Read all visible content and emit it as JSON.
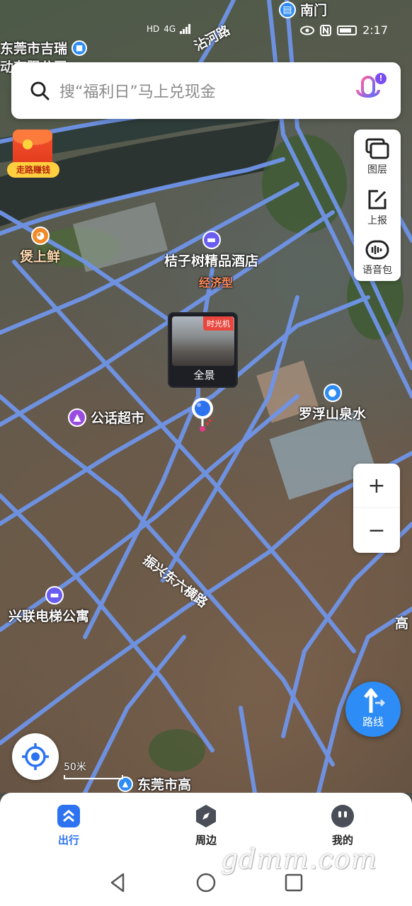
{
  "status_bar": {
    "indicators": [
      "HD",
      "4G",
      "signal"
    ],
    "time": "2:17",
    "right_icons": [
      "eye-icon",
      "nfc-icon",
      "battery-icon"
    ]
  },
  "search": {
    "placeholder": "搜“福利日”马上兑现金",
    "voice_badge": "!"
  },
  "envelope": {
    "label": "走路赚钱"
  },
  "tools": [
    {
      "label": "图层",
      "icon": "layers-icon"
    },
    {
      "label": "上报",
      "icon": "edit-report-icon"
    },
    {
      "label": "语音包",
      "icon": "voice-pack-icon"
    }
  ],
  "map": {
    "labels": {
      "company": "东莞市吉瑞",
      "company_line2": "动有限公司",
      "nanmen": "南门",
      "road_zhanhe": "沾河路",
      "food": "煲上鲜",
      "hotel": "桔子树精品酒店",
      "hotel_type": "经济型",
      "market": "公话超市",
      "water": "罗浮山泉水",
      "road_zhenxing": "振兴东六横路",
      "apartment": "兴联电梯公寓",
      "edge_right": "高",
      "bottom_poi": "东莞市高"
    }
  },
  "street_view": {
    "tag": "时光机",
    "caption": "全景"
  },
  "zoom": {
    "in": "+",
    "out": "−"
  },
  "route": {
    "label": "路线"
  },
  "scale": {
    "label": "50米"
  },
  "tabs": [
    {
      "label": "出行",
      "active": true,
      "icon": "travel-icon"
    },
    {
      "label": "周边",
      "active": false,
      "icon": "compass-icon"
    },
    {
      "label": "我的",
      "active": false,
      "icon": "profile-icon"
    }
  ],
  "watermark": "gdmm.com",
  "colors": {
    "accent": "#2d73f0",
    "road": "#6f94e8",
    "route_button": "#2d8cf5"
  }
}
